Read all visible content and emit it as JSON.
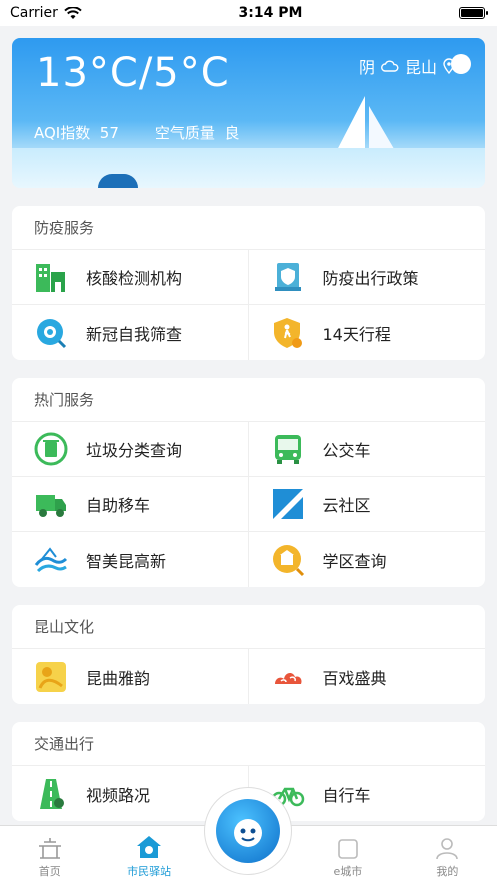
{
  "status": {
    "carrier": "Carrier",
    "time": "3:14 PM"
  },
  "weather": {
    "temperature": "13°C/5°C",
    "aqi_label": "AQI指数",
    "aqi_value": "57",
    "quality_label": "空气质量",
    "quality_value": "良",
    "condition": "阴",
    "city": "昆山"
  },
  "sections": {
    "epidemic": {
      "title": "防疫服务",
      "items": [
        "核酸检测机构",
        "防疫出行政策",
        "新冠自我筛查",
        "14天行程"
      ]
    },
    "hot": {
      "title": "热门服务",
      "items": [
        "垃圾分类查询",
        "公交车",
        "自助移车",
        "云社区",
        "智美昆高新",
        "学区查询"
      ]
    },
    "culture": {
      "title": "昆山文化",
      "items": [
        "昆曲雅韵",
        "百戏盛典"
      ]
    },
    "traffic": {
      "title": "交通出行",
      "items": [
        "视频路况",
        "自行车"
      ]
    }
  },
  "tabbar": {
    "home": "首页",
    "station": "市民驿站",
    "ecity": "e城市",
    "mine": "我的"
  },
  "colors": {
    "accent": "#1a9ad6",
    "sky": "#2e9af0"
  }
}
